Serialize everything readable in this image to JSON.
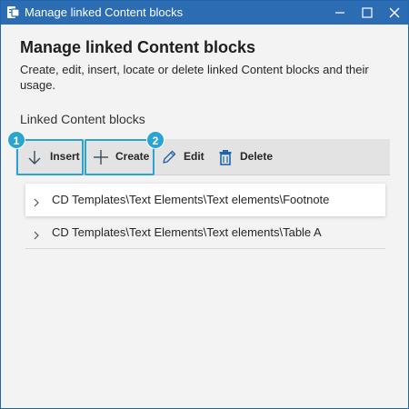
{
  "window": {
    "title": "Manage linked Content blocks",
    "titlebar_color": "#2b6cb3"
  },
  "header": {
    "heading": "Manage linked Content blocks",
    "description": "Create, edit, insert, locate or delete linked Content blocks and their usage."
  },
  "section": {
    "label": "Linked Content blocks"
  },
  "toolbar": {
    "insert_label": "Insert",
    "create_label": "Create",
    "edit_label": "Edit",
    "delete_label": "Delete"
  },
  "callouts": {
    "badge_1": "1",
    "badge_2": "2",
    "color": "#2aa5d3"
  },
  "list": {
    "items": [
      {
        "label": "CD Templates\\Text Elements\\Text elements\\Footnote",
        "selected": true
      },
      {
        "label": "CD Templates\\Text Elements\\Text elements\\Table A",
        "selected": false
      }
    ]
  }
}
